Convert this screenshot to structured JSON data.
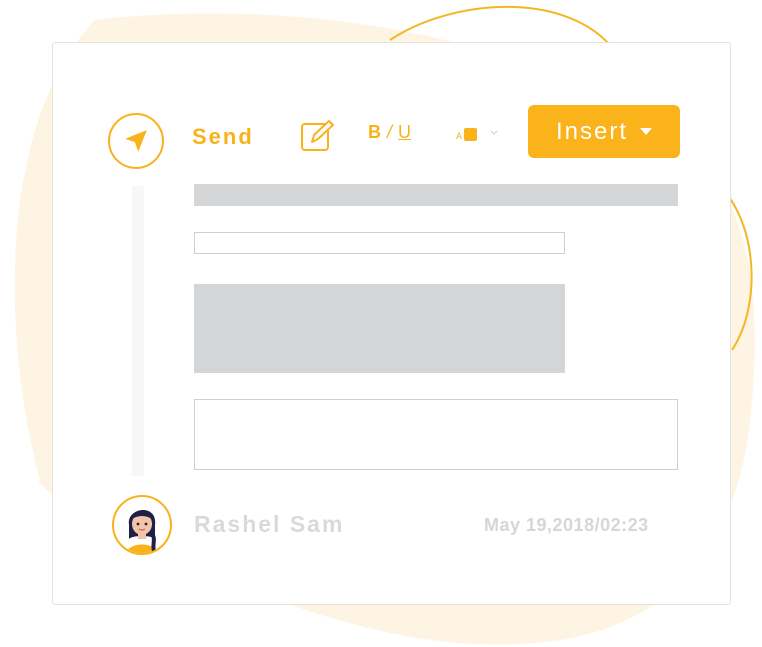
{
  "toolbar": {
    "send_label": "Send",
    "bold_label": "B",
    "italic_label": "/",
    "underline_label": "U",
    "insert_label": "Insert"
  },
  "message": {
    "author": "Rashel Sam",
    "timestamp": "May 19,2018/02:23"
  },
  "colors": {
    "accent": "#f9b21a",
    "blob": "#fef4e3",
    "placeholder": "#d4d5d7"
  },
  "icons": [
    "send-icon",
    "edit-icon",
    "text-color-icon",
    "chevron-down-icon",
    "caret-down-icon"
  ]
}
